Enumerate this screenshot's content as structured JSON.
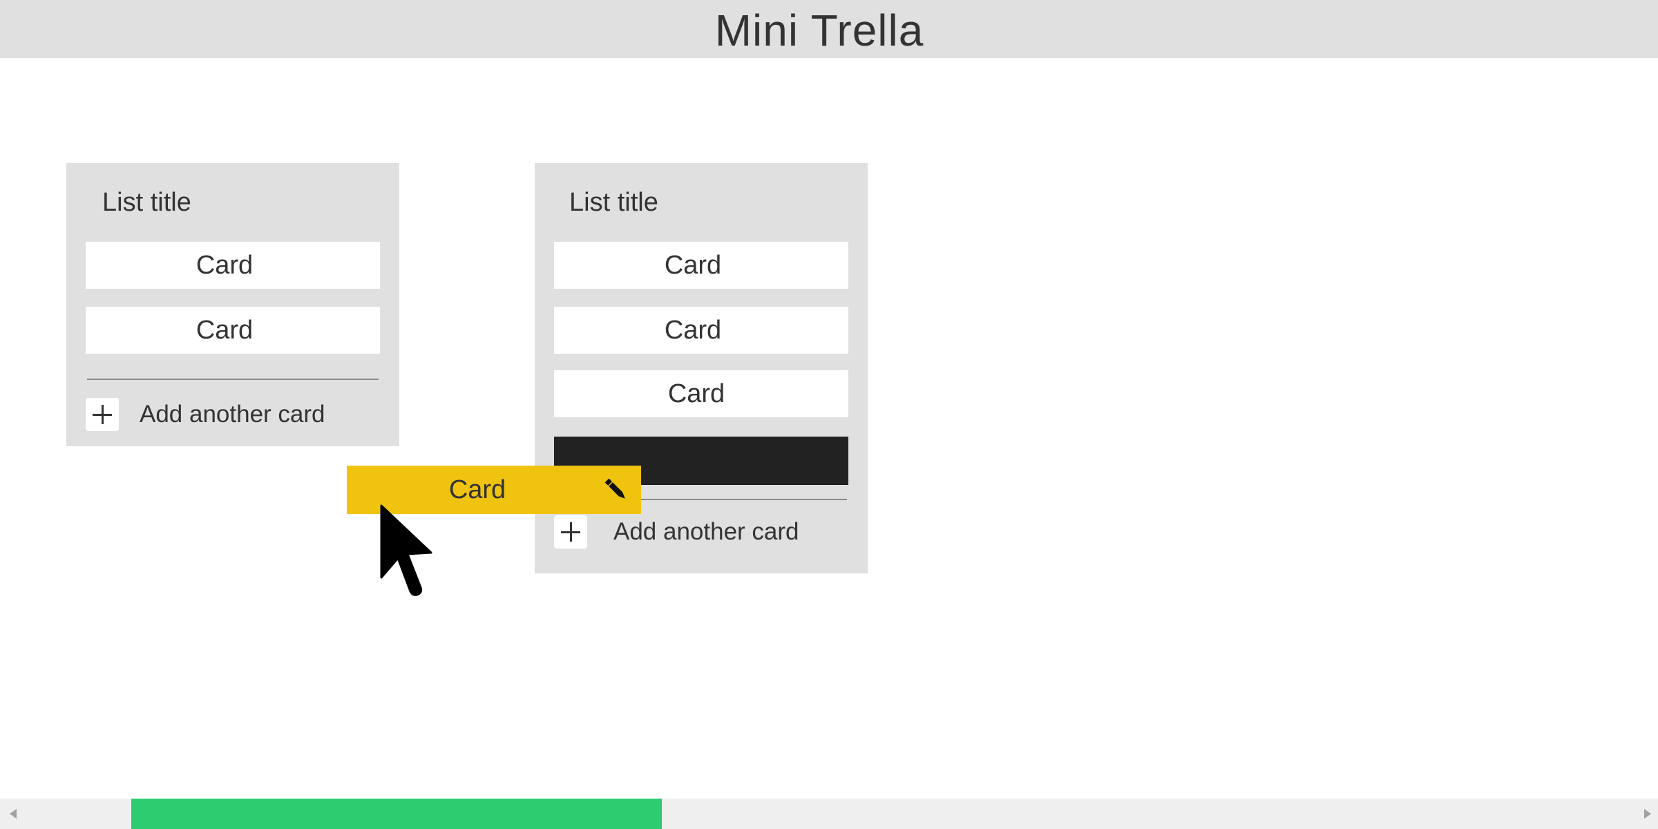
{
  "app": {
    "title": "Mini Trella"
  },
  "lists": [
    {
      "title": "List title",
      "cards": [
        "Card",
        "Card"
      ],
      "add_label": "Add another card"
    },
    {
      "title": "List title",
      "cards": [
        "Card",
        "Card",
        "Card"
      ],
      "add_label": "Add another card"
    }
  ],
  "dragged_card": {
    "label": "Card",
    "icon": "pencil-icon",
    "color": "#f0c30f"
  },
  "colors": {
    "header_bg": "#e0e0e0",
    "list_bg": "#e0e0e0",
    "drop_placeholder": "#222222",
    "scroll_thumb": "#2ecc71"
  },
  "scrollbar": {
    "thumb_start_fraction": 0.08,
    "thumb_size_fraction": 0.32
  }
}
